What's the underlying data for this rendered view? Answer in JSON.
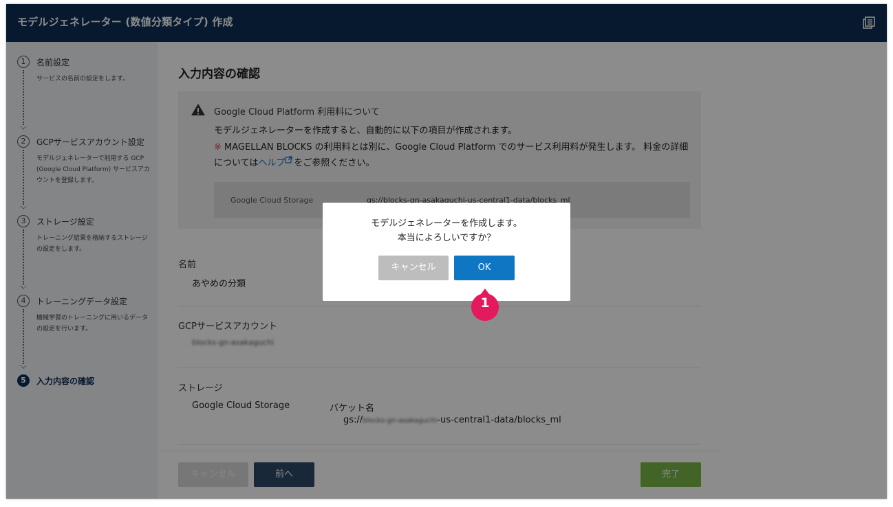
{
  "window": {
    "title": "モデルジェネレーター (数値分類タイプ) 作成",
    "doc_icon": "document-list-icon"
  },
  "sidebar": {
    "steps": [
      {
        "num": "1",
        "label": "名前設定",
        "desc": "サービスの名前の設定をします。"
      },
      {
        "num": "2",
        "label": "GCPサービスアカウント設定",
        "desc": "モデルジェネレーターで利用する GCP (Google Cloud Platform) サービスアカウントを登録します。"
      },
      {
        "num": "3",
        "label": "ストレージ設定",
        "desc": "トレーニング結果を格納するストレージの設定をします。"
      },
      {
        "num": "4",
        "label": "トレーニングデータ設定",
        "desc": "機械学習のトレーニングに用いるデータの設定を行います。"
      },
      {
        "num": "5",
        "label": "入力内容の確認",
        "desc": ""
      }
    ]
  },
  "main": {
    "title": "入力内容の確認",
    "notice": {
      "heading": "Google Cloud Platform 利用料について",
      "line1": "モデルジェネレーターを作成すると、自動的に以下の項目が作成されます。",
      "mark": "※",
      "line2": " MAGELLAN BLOCKS の利用料とは別に、Google Cloud Platform でのサービス利用料が発生します。 料金の詳細については",
      "help_link": "ヘルプ",
      "line2_end": "をご参照ください。",
      "storage_key": "Google Cloud Storage",
      "storage_value": "gs://blocks-gn-asakaguchi-us-central1-data/blocks_ml"
    },
    "name_label": "名前",
    "name_value": "あやめの分類",
    "gcp_label": "GCPサービスアカウント",
    "gcp_value": "blocks-gn-asakaguchi",
    "storage_label": "ストレージ",
    "storage_type": "Google Cloud Storage",
    "bucket_label": "バケット名",
    "bucket_prefix": "gs://",
    "bucket_blurred": "blocks-gn-asakaguchi",
    "bucket_suffix": "-us-central1-data/blocks_ml"
  },
  "footer": {
    "cancel": "キャンセル",
    "prev": "前へ",
    "done": "完了"
  },
  "dialog": {
    "line1": "モデルジェネレーターを作成します。",
    "line2": "本当によろしいですか？",
    "cancel": "キャンセル",
    "ok": "OK"
  },
  "callout": {
    "number": "1"
  },
  "colors": {
    "header": "#0b2f57",
    "ok": "#0e76c2",
    "done": "#7ab648",
    "callout": "#e5195e",
    "warning_mark": "#d9374b"
  }
}
